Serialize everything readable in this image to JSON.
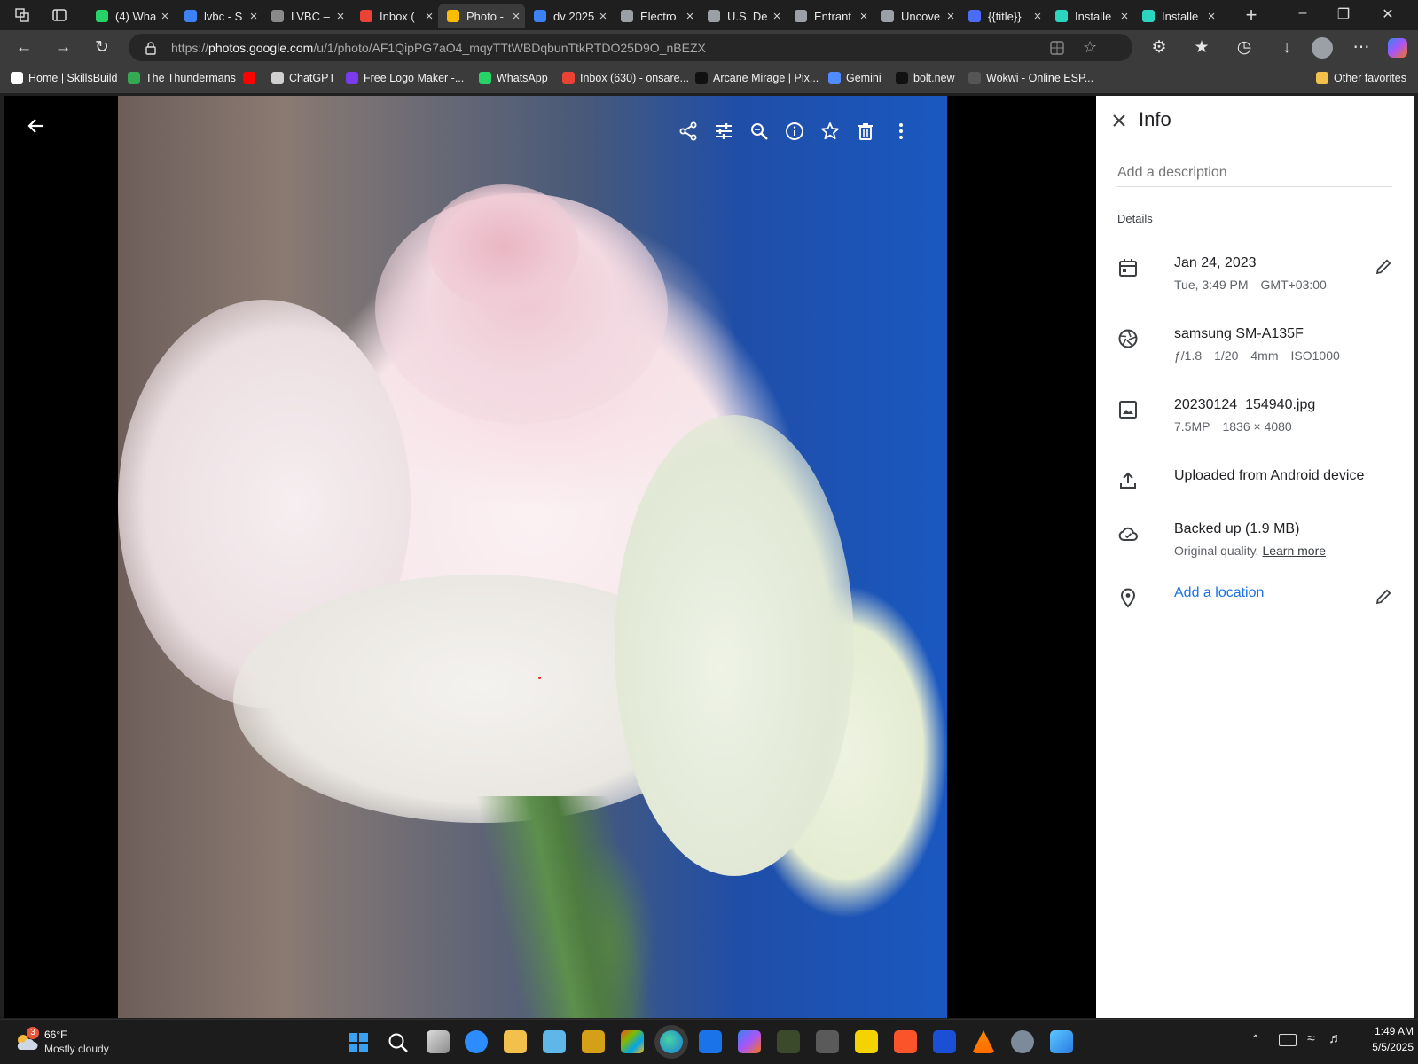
{
  "browser": {
    "tabs": [
      {
        "label": "(4) Wha",
        "color": "#25d366"
      },
      {
        "label": "lvbc - S",
        "color": "#3b82f6"
      },
      {
        "label": "LVBC –",
        "color": "#8a8a8a"
      },
      {
        "label": "Inbox (",
        "color": "#ea4335"
      },
      {
        "label": "Photo -",
        "color": "#fbbc04",
        "active": true
      },
      {
        "label": "dv 2025",
        "color": "#3b82f6"
      },
      {
        "label": "Electro",
        "color": "#9aa0a6"
      },
      {
        "label": "U.S. De",
        "color": "#9aa0a6"
      },
      {
        "label": "Entrant",
        "color": "#9aa0a6"
      },
      {
        "label": "Uncove",
        "color": "#9aa0a6"
      },
      {
        "label": "{{title}}",
        "color": "#4a6cf7"
      },
      {
        "label": "Installe",
        "color": "#2dd4bf"
      },
      {
        "label": "Installe",
        "color": "#2dd4bf"
      }
    ],
    "new_tab_icon": "plus-icon",
    "url_prefix": "https://",
    "url_host": "photos.google.com",
    "url_path": "/u/1/photo/AF1QipPG7aO4_mqyTTtWBDqbunTtkRTDO25D9O_nBEZX",
    "bookmarks": [
      {
        "label": "Home | SkillsBuild",
        "color": "#ffffff"
      },
      {
        "label": "The Thundermans",
        "color": "#34a853"
      },
      {
        "label": "",
        "color": "#ff0000"
      },
      {
        "label": "ChatGPT",
        "color": "#d0d0d0"
      },
      {
        "label": "Free Logo Maker -...",
        "color": "#7c3aed"
      },
      {
        "label": "WhatsApp",
        "color": "#25d366"
      },
      {
        "label": "Inbox (630) - onsare...",
        "color": "#ea4335"
      },
      {
        "label": "Arcane Mirage | Pix...",
        "color": "#111111"
      },
      {
        "label": "Gemini",
        "color": "#4f8cff"
      },
      {
        "label": "bolt.new",
        "color": "#111111"
      },
      {
        "label": "Wokwi - Online ESP...",
        "color": "#555555"
      }
    ],
    "other_favorites": "Other favorites"
  },
  "viewer": {
    "toolbar": [
      {
        "name": "share-icon"
      },
      {
        "name": "edit-adjust-icon"
      },
      {
        "name": "zoom-icon"
      },
      {
        "name": "info-icon"
      },
      {
        "name": "star-icon"
      },
      {
        "name": "delete-icon"
      },
      {
        "name": "more-vert-icon"
      }
    ]
  },
  "info": {
    "title": "Info",
    "description_placeholder": "Add a description",
    "details_heading": "Details",
    "date": "Jan 24, 2023",
    "date_sub": [
      "Tue, 3:49 PM",
      "GMT+03:00"
    ],
    "camera": "samsung SM-A135F",
    "camera_sub": [
      "ƒ/1.8",
      "1/20",
      "4mm",
      "ISO1000"
    ],
    "file": "20230124_154940.jpg",
    "file_sub": [
      "7.5MP",
      "1836 × 4080"
    ],
    "upload": "Uploaded from Android device",
    "backup": "Backed up (1.9 MB)",
    "backup_sub": "Original quality.",
    "learn_more": "Learn more",
    "location": "Add a location",
    "link_color": "#1a73e8"
  },
  "taskbar": {
    "weather_temp": "66°F",
    "weather_desc": "Mostly cloudy",
    "weather_badge": "3",
    "time": "1:49 AM",
    "date": "5/5/2025"
  }
}
